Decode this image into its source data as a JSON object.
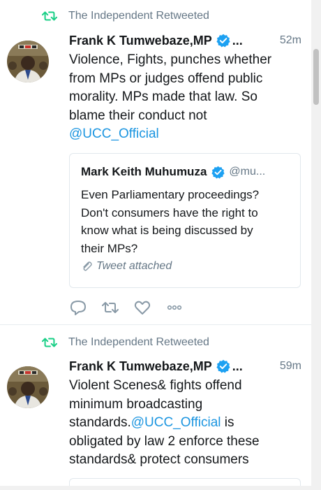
{
  "tweets": [
    {
      "retweeted_by": "The Independent Retweeted",
      "author_name": "Frank K Tumwebaze,MP",
      "name_ellipsis": "...",
      "time": "52m",
      "text_lines": [
        "Violence, Fights, punches whether",
        "from MPs or judges offend public",
        "morality. MPs made that law. So",
        "blame their conduct not"
      ],
      "mention": "@UCC_Official",
      "quoted": {
        "author_name": "Mark Keith Muhumuza",
        "handle": "@mu...",
        "text_lines": [
          "Even Parliamentary proceedings?",
          "Don't consumers have the right to",
          "know what is being discussed by",
          "their MPs?"
        ],
        "attachment": "Tweet attached"
      },
      "actions": [
        "reply-icon",
        "retweet-icon",
        "like-icon",
        "more-icon"
      ]
    },
    {
      "retweeted_by": "The Independent Retweeted",
      "author_name": "Frank K Tumwebaze,MP",
      "name_ellipsis": "...",
      "time": "59m",
      "line1": "Violent Scenes& fights offend",
      "line2": "minimum broadcasting",
      "line3_prefix": "standards.",
      "mention": "@UCC_Official",
      "line3_suffix": " is",
      "line4": "obligated by law 2 enforce these",
      "line5": "standards& protect consumers"
    }
  ],
  "colors": {
    "accent": "#1b95e0",
    "retweet_green": "#19cf86",
    "verified_blue": "#1da1f2",
    "secondary_text": "#657786"
  }
}
